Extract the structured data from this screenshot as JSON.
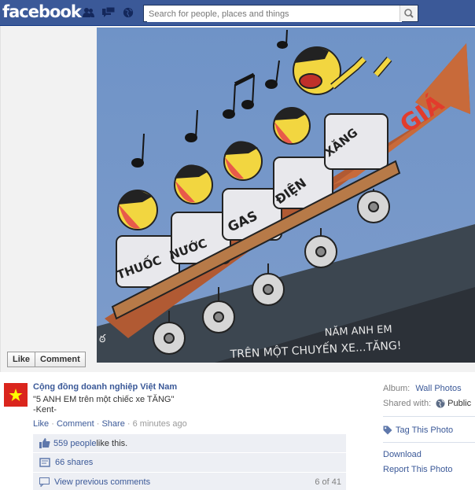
{
  "header": {
    "logo": "facebook",
    "search_placeholder": "Search for people, places and things"
  },
  "photo": {
    "description_icon": "cartoon-photo",
    "texts": {
      "gia": "GIÁ",
      "xang": "XĂNG",
      "dien": "ĐIỆN",
      "gas": "GAS",
      "nuoc": "NƯỚC",
      "thuoc": "THUỐC",
      "caption_line1": "NĂM ANH EM",
      "caption_line2": "TRÊN MỘT CHUYẾN XE...TĂNG!"
    }
  },
  "like_bar": {
    "like": "Like",
    "comment": "Comment"
  },
  "post": {
    "page_name": "Cộng đồng doanh nghiệp Việt Nam",
    "caption_line1": "\"5 ANH EM trên một chiếc xe TĂNG\"",
    "caption_line2": "-Kent-",
    "actions": {
      "like": "Like",
      "comment": "Comment",
      "share": "Share",
      "time": "6 minutes ago",
      "sep": "·"
    },
    "likes": {
      "count_link": "559 people",
      "suffix": " like this."
    },
    "shares": "66 shares",
    "view_previous": "View previous comments",
    "pager": "6 of 41"
  },
  "sidebar": {
    "album_label": "Album:",
    "album_value": "Wall Photos",
    "shared_label": "Shared with:",
    "shared_value": "Public",
    "tag_photo": "Tag This Photo",
    "download": "Download",
    "report": "Report This Photo"
  },
  "colors": {
    "brand": "#3b5998",
    "flag_red": "#da251d",
    "flag_star": "#ffff00"
  }
}
